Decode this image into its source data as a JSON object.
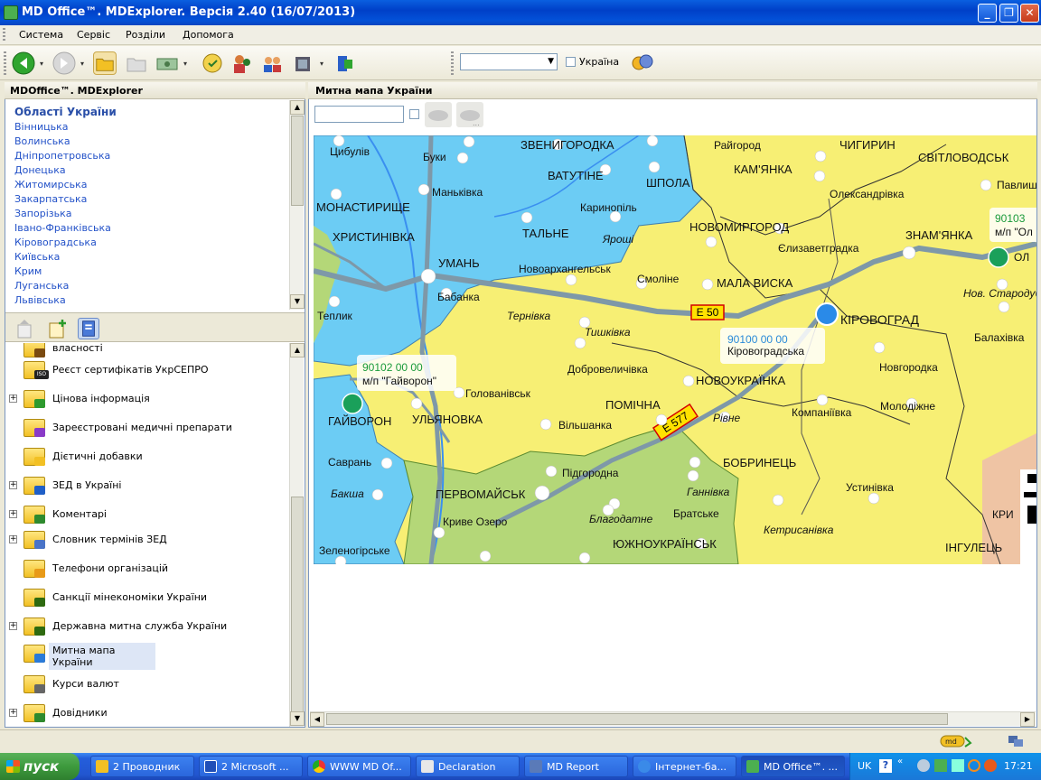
{
  "window": {
    "title": "MD Office™. MDExplorer. Версія 2.40 (16/07/2013)",
    "min_label": "_",
    "max_label": "❐",
    "close_label": "✕"
  },
  "menu": [
    "Система",
    "Сервіс",
    "Розділи",
    "Допомога"
  ],
  "toolbar": {
    "select_value": "",
    "checkbox_label": "Україна"
  },
  "left_panel": {
    "title": "MDOffice™. MDExplorer",
    "regions_title": "Області України",
    "regions": [
      "Вінницька",
      "Волинська",
      "Дніпропетровська",
      "Донецька",
      "Житомирська",
      "Закарпатська",
      "Запорізька",
      "Івано-Франківська",
      "Кіровоградська",
      "Київська",
      "Крим",
      "Луганська",
      "Львівська"
    ],
    "tree": [
      {
        "label": "власності",
        "expander": false,
        "badge": "#7a4a10"
      },
      {
        "label": "Реєст сертифікатів УкрСЕПРО",
        "expander": false,
        "badge": "#222222",
        "badge_text": "ISO"
      },
      {
        "label": "Цінова інформація",
        "expander": true,
        "badge": "#2e9a2e"
      },
      {
        "label": "Зареєстровані медичні препарати",
        "expander": false,
        "badge": "#8a3ac8"
      },
      {
        "label": "Дієтичні добавки",
        "expander": false,
        "badge": "#f2c024"
      },
      {
        "label": "ЗЕД в Україні",
        "expander": true,
        "badge": "#1f5fc8"
      },
      {
        "label": "Коментарі",
        "expander": true,
        "badge": "#2e8a2e"
      },
      {
        "label": "Словник термінів ЗЕД",
        "expander": true,
        "badge": "#4a74c8"
      },
      {
        "label": "Телефони організацій",
        "expander": false,
        "badge": "#e89a18"
      },
      {
        "label": "Санкції мінекономіки України",
        "expander": false,
        "badge": "#2e6a10"
      },
      {
        "label": "Державна митна служба України",
        "expander": true,
        "badge": "#2e6a10"
      },
      {
        "label": "Митна мапа України",
        "expander": false,
        "badge": "#2a7ad8",
        "selected": true
      },
      {
        "label": "Курси валют",
        "expander": false,
        "badge": "#666666"
      },
      {
        "label": "Довідники",
        "expander": true,
        "badge": "#2e8a2e"
      }
    ]
  },
  "right_panel": {
    "title": "Митна мапа України",
    "search_value": ""
  },
  "map": {
    "cities": [
      {
        "name": "Цибулів"
      },
      {
        "name": "Буки"
      },
      {
        "name": "ЗВЕНИГОРОДКА",
        "major": true
      },
      {
        "name": "Райгород"
      },
      {
        "name": "ЧИГИРИН",
        "major": true
      },
      {
        "name": "СВІТЛОВОДСЬК",
        "major": true
      },
      {
        "name": "ВАТУТІНЕ",
        "major": true
      },
      {
        "name": "КАМ'ЯНКА",
        "major": true
      },
      {
        "name": "Маньківка"
      },
      {
        "name": "ШПОЛА",
        "major": true
      },
      {
        "name": "МОНАСТИРИЩЕ",
        "major": true
      },
      {
        "name": "Каринопіль"
      },
      {
        "name": "Олександрівка"
      },
      {
        "name": "Павлиш"
      },
      {
        "name": "ХРИСТИНІВКА",
        "major": true
      },
      {
        "name": "ТАЛЬНЕ",
        "major": true
      },
      {
        "name": "Яроші"
      },
      {
        "name": "НОВОМИРГОРОД",
        "major": true
      },
      {
        "name": "Єлизаветградка"
      },
      {
        "name": "ЗНАМ'ЯНКА",
        "major": true
      },
      {
        "name": "УМАНЬ",
        "major": true
      },
      {
        "name": "Новоархангельськ"
      },
      {
        "name": "Смоліне"
      },
      {
        "name": "МАЛА ВИСКА",
        "major": true
      },
      {
        "name": "Бабанка"
      },
      {
        "name": "Нов. Стародуб"
      },
      {
        "name": "Теплик"
      },
      {
        "name": "Тернівка"
      },
      {
        "name": "КІРОВОГРАД",
        "major": true
      },
      {
        "name": "Тишківка"
      },
      {
        "name": "Балахівка"
      },
      {
        "name": "Добровеличівка"
      },
      {
        "name": "Новгородка"
      },
      {
        "name": "НОВОУКРАЇНКА",
        "major": true
      },
      {
        "name": "Голованівськ"
      },
      {
        "name": "ПОМІЧНА",
        "major": true
      },
      {
        "name": "Компаніївка"
      },
      {
        "name": "Молодіжне"
      },
      {
        "name": "ГАЙВОРОН",
        "major": true
      },
      {
        "name": "УЛЬЯНОВКА",
        "major": true
      },
      {
        "name": "Вільшанка"
      },
      {
        "name": "Рівне"
      },
      {
        "name": "Саврань"
      },
      {
        "name": "Підгородна"
      },
      {
        "name": "БОБРИНЕЦЬ",
        "major": true
      },
      {
        "name": "Бакша"
      },
      {
        "name": "ПЕРВОМАЙСЬК",
        "major": true
      },
      {
        "name": "Ганнівка"
      },
      {
        "name": "Устинівка"
      },
      {
        "name": "Братське"
      },
      {
        "name": "Кетрисанівка"
      },
      {
        "name": "Криве Озеро"
      },
      {
        "name": "Благодатне"
      },
      {
        "name": "ЮЖНОУКРАЇНСЬК",
        "major": true
      },
      {
        "name": "Зеленогірське"
      },
      {
        "name": "ІНГУЛЕЦЬ",
        "major": true
      },
      {
        "name": "КРИ"
      },
      {
        "name": "ОЛ"
      }
    ],
    "road_labels": [
      "E 50",
      "E 577"
    ],
    "customs": [
      {
        "code": "90102 00 00",
        "name": "м/п \"Гайворон\""
      },
      {
        "code": "90100 00 00",
        "name": "Кіровоградська"
      },
      {
        "code": "90103",
        "name": "м/п \"Ол"
      }
    ]
  },
  "taskbar": {
    "start": "пуск",
    "tasks": [
      "2 Проводник",
      "2 Microsoft ...",
      "WWW MD Of...",
      "Declaration",
      "MD Report",
      "Інтернет-ба...",
      "MD Office™. ..."
    ],
    "lang": "UK",
    "clock": "17:21"
  }
}
